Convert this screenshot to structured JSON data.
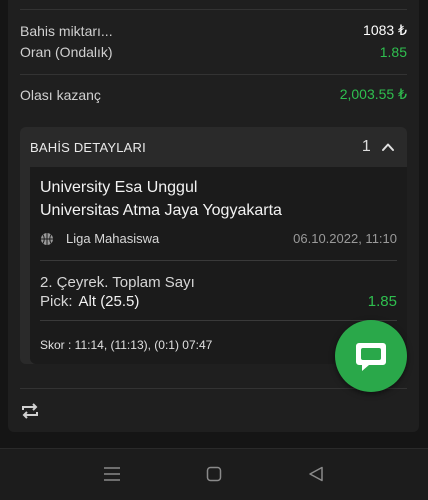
{
  "summary": {
    "stake_label": "Bahis miktarı...",
    "stake_value": "1083 ₺",
    "odds_label": "Oran (Ondalık)",
    "odds_value": "1.85",
    "win_label": "Olası kazanç",
    "win_value": "2,003.55 ₺"
  },
  "details": {
    "title": "BAHİS DETAYLARI",
    "count": "1",
    "team1": "University Esa Unggul",
    "team2": "Universitas Atma Jaya Yogyakarta",
    "league": "Liga Mahasiswa",
    "date": "06.10.2022, 11:10",
    "market": "2. Çeyrek. Toplam Sayı",
    "pick_label": "Pick:",
    "pick_value": "Alt (25.5)",
    "pick_odds": "1.85",
    "score": "Skor : 11:14, (11:13), (0:1) 07:47"
  },
  "colors": {
    "accent_green": "#2fbf4f",
    "fab_green": "#2aa84a",
    "background": "#151515",
    "panel": "#1f1f1f"
  },
  "icons": {
    "collapse": "chevron-up-icon",
    "sport": "basketball-icon",
    "repeat": "repeat-icon",
    "chat": "chat-icon",
    "nav_menu": "menu-icon",
    "nav_home": "home-icon",
    "nav_back": "back-icon"
  }
}
